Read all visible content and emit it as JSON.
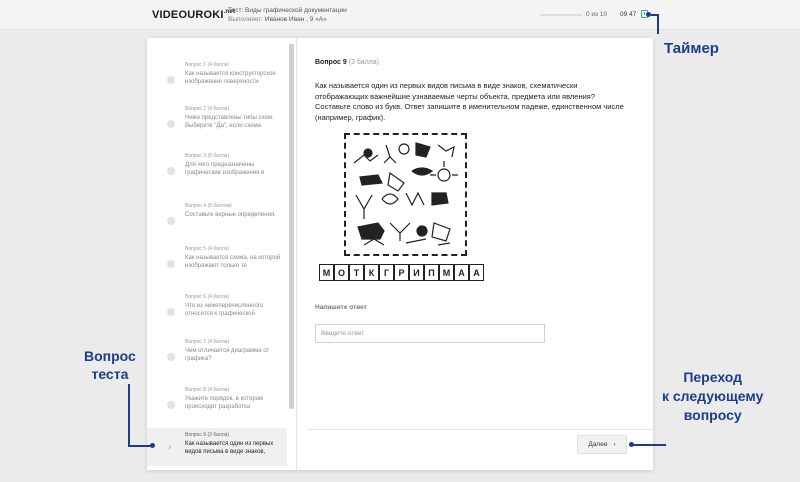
{
  "header": {
    "logo": "VIDEOUROKI",
    "logo_suffix": ".net",
    "test_label": "Тест: Виды графической документации",
    "performer_label": "Выполняет:",
    "performer": "Иванов Иван , 9 «А»",
    "progress_text": "0 из 10",
    "progress": 0,
    "timer": "09 47"
  },
  "sidebar": {
    "items": [
      {
        "title": "Вопрос 1 (4 балла)",
        "text": "Как называется конструкторское изображение поверхности"
      },
      {
        "title": "Вопрос 2 (4 балла)",
        "text": "Ниже представлены типы схем. Выберите \"Да\", если схема"
      },
      {
        "title": "Вопрос 3 (8 балла)",
        "text": "Для чего предназначены графические изображения в"
      },
      {
        "title": "Вопрос 4 (8 баллов)",
        "text": "Составьте верные определения."
      },
      {
        "title": "Вопрос 5 (4 балла)",
        "text": "Как называется схема, на которой изображают только те"
      },
      {
        "title": "Вопрос 6 (4 балла)",
        "text": "Что из нижеперечисленного относится к графической"
      },
      {
        "title": "Вопрос 7 (4 балла)",
        "text": "Чем отличается диаграмма от графика?"
      },
      {
        "title": "Вопрос 8 (4 балла)",
        "text": "Укажите порядок, в котором происходит разработка"
      },
      {
        "title": "Вопрос 9 (3 балла)",
        "text": "Как называется один из первых видов письма в виде знаков,"
      }
    ]
  },
  "question": {
    "number": "Вопрос 9",
    "points": "(3 балла)",
    "text": "Как называется один из первых видов письма в виде знаков, схематически отображающих важнейшие узнаваемые черты объекта, предмета или явления? Составьте слово из букв. Ответ запишите в именительном падеже, единственном числе (например, график).",
    "letters": [
      "М",
      "О",
      "Т",
      "К",
      "Г",
      "Р",
      "И",
      "П",
      "М",
      "А",
      "А"
    ],
    "answer_label": "Напишите ответ",
    "answer_placeholder": "Введите ответ",
    "answer_value": "",
    "next_label": "Далее"
  },
  "annotations": {
    "timer": "Таймер",
    "question_line1": "Вопрос",
    "question_line2": "теста",
    "next_line1": "Переход",
    "next_line2": "к следующему",
    "next_line3": "вопросу"
  },
  "colors": {
    "annotation": "#1d3d8a",
    "timer_icon": "#3bb07a"
  }
}
